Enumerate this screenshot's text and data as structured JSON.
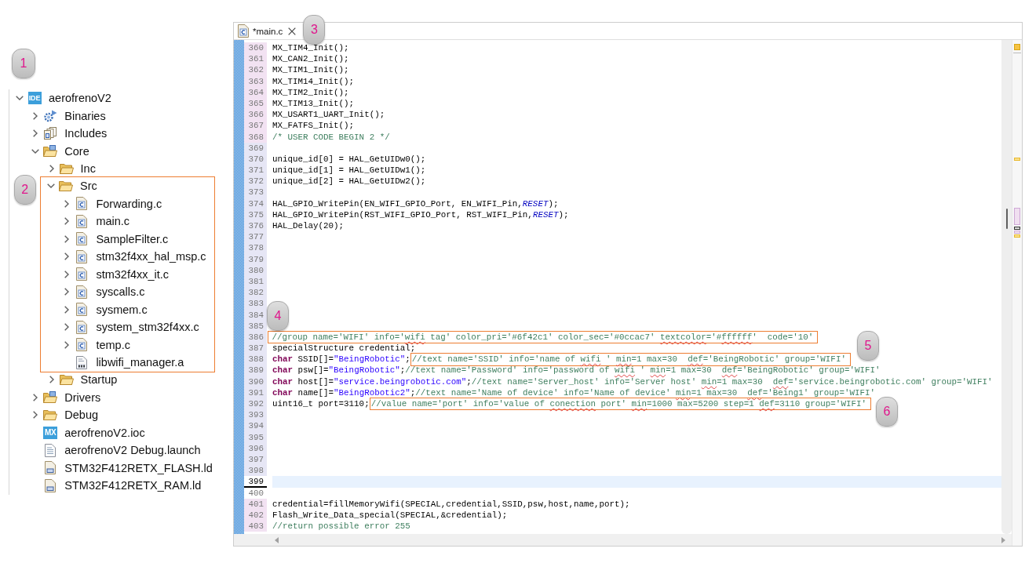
{
  "explorer": {
    "callout": "1",
    "tree": [
      {
        "label": "aerofrenoV2",
        "kind": "project",
        "badge": "IDE",
        "expanded": true,
        "highlighted": false,
        "children": [
          {
            "label": "Binaries",
            "kind": "binaries",
            "expanded": false,
            "highlighted": false
          },
          {
            "label": "Includes",
            "kind": "includes",
            "expanded": false,
            "highlighted": false
          },
          {
            "label": "Core",
            "kind": "source-folder",
            "expanded": true,
            "highlighted": false,
            "children": [
              {
                "label": "Inc",
                "kind": "folder",
                "expanded": false,
                "highlighted": false
              },
              {
                "label": "Src",
                "kind": "folder",
                "expanded": true,
                "highlighted": true,
                "callout": "2",
                "children": [
                  {
                    "label": "Forwarding.c",
                    "kind": "c-file",
                    "expanded": false,
                    "highlighted": false
                  },
                  {
                    "label": "main.c",
                    "kind": "c-file",
                    "expanded": false,
                    "highlighted": false
                  },
                  {
                    "label": "SampleFilter.c",
                    "kind": "c-file",
                    "expanded": false,
                    "highlighted": false
                  },
                  {
                    "label": "stm32f4xx_hal_msp.c",
                    "kind": "c-file",
                    "expanded": false,
                    "highlighted": false
                  },
                  {
                    "label": "stm32f4xx_it.c",
                    "kind": "c-file",
                    "expanded": false,
                    "highlighted": false
                  },
                  {
                    "label": "syscalls.c",
                    "kind": "c-file",
                    "expanded": false,
                    "highlighted": false
                  },
                  {
                    "label": "sysmem.c",
                    "kind": "c-file",
                    "expanded": false,
                    "highlighted": false
                  },
                  {
                    "label": "system_stm32f4xx.c",
                    "kind": "c-file",
                    "expanded": false,
                    "highlighted": false
                  },
                  {
                    "label": "temp.c",
                    "kind": "c-file",
                    "expanded": false,
                    "highlighted": false
                  },
                  {
                    "label": "libwifi_manager.a",
                    "kind": "archive",
                    "highlighted": false
                  }
                ]
              },
              {
                "label": "Startup",
                "kind": "folder",
                "expanded": false,
                "highlighted": false
              }
            ]
          },
          {
            "label": "Drivers",
            "kind": "source-folder",
            "expanded": false,
            "highlighted": false
          },
          {
            "label": "Debug",
            "kind": "folder",
            "expanded": false,
            "highlighted": false
          },
          {
            "label": "aerofrenoV2.ioc",
            "kind": "ioc",
            "badge": "MX",
            "highlighted": false
          },
          {
            "label": "aerofrenoV2 Debug.launch",
            "kind": "launch",
            "highlighted": false
          },
          {
            "label": "STM32F412RETX_FLASH.ld",
            "kind": "linker",
            "highlighted": false
          },
          {
            "label": "STM32F412RETX_RAM.ld",
            "kind": "linker",
            "highlighted": false
          }
        ]
      }
    ]
  },
  "editor": {
    "tabs": [
      {
        "label": "*main.c",
        "selected": true,
        "callout": "3"
      }
    ],
    "lines": [
      {
        "number": "360",
        "kind": "changed",
        "current": false,
        "segments": [
          {
            "kind": "code",
            "text": "MX_TIM4_Init();"
          }
        ]
      },
      {
        "number": "361",
        "kind": "changed",
        "current": false,
        "segments": [
          {
            "kind": "code",
            "text": "MX_CAN2_Init();"
          }
        ]
      },
      {
        "number": "362",
        "kind": "changed",
        "current": false,
        "segments": [
          {
            "kind": "code",
            "text": "MX_TIM1_Init();"
          }
        ]
      },
      {
        "number": "363",
        "kind": "changed",
        "current": false,
        "segments": [
          {
            "kind": "code",
            "text": "MX_TIM14_Init();"
          }
        ]
      },
      {
        "number": "364",
        "kind": "changed",
        "current": false,
        "segments": [
          {
            "kind": "code",
            "text": "MX_TIM2_Init();"
          }
        ]
      },
      {
        "number": "365",
        "kind": "changed",
        "current": false,
        "segments": [
          {
            "kind": "code",
            "text": "MX_TIM13_Init();"
          }
        ]
      },
      {
        "number": "366",
        "kind": "changed",
        "current": false,
        "segments": [
          {
            "kind": "code",
            "text": "MX_USART1_UART_Init();"
          }
        ]
      },
      {
        "number": "367",
        "kind": "changed",
        "current": false,
        "segments": [
          {
            "kind": "code",
            "text": "MX_FATFS_Init();"
          }
        ]
      },
      {
        "number": "368",
        "kind": "changed",
        "current": false,
        "segments": [
          {
            "kind": "comment",
            "text": "/* USER CODE BEGIN 2 */"
          }
        ]
      },
      {
        "number": "369",
        "kind": "added",
        "current": false
      },
      {
        "number": "370",
        "kind": "added",
        "current": false,
        "segments": [
          {
            "kind": "code",
            "text": "unique_id[0] = HAL_GetUIDw0();"
          }
        ]
      },
      {
        "number": "371",
        "kind": "added",
        "current": false,
        "segments": [
          {
            "kind": "code",
            "text": "unique_id[1] = HAL_GetUIDw1();"
          }
        ]
      },
      {
        "number": "372",
        "kind": "added",
        "current": false,
        "segments": [
          {
            "kind": "code",
            "text": "unique_id[2] = HAL_GetUIDw2();"
          }
        ]
      },
      {
        "number": "373",
        "kind": "added",
        "current": false
      },
      {
        "number": "374",
        "kind": "added",
        "current": false,
        "segments": [
          {
            "kind": "code",
            "text": "HAL_GPIO_WritePin(EN_WIFI_GPIO_Port, EN_WIFI_Pin,"
          },
          {
            "kind": "constant",
            "text": "RESET"
          },
          {
            "kind": "code",
            "text": ");"
          }
        ]
      },
      {
        "number": "375",
        "kind": "added",
        "current": false,
        "segments": [
          {
            "kind": "code",
            "text": "HAL_GPIO_WritePin(RST_WIFI_GPIO_Port, RST_WIFI_Pin,"
          },
          {
            "kind": "constant",
            "text": "RESET"
          },
          {
            "kind": "code",
            "text": ");"
          }
        ]
      },
      {
        "number": "376",
        "kind": "added",
        "current": false,
        "segments": [
          {
            "kind": "code",
            "text": "HAL_Delay(20);"
          }
        ]
      },
      {
        "number": "377",
        "kind": "added",
        "current": false
      },
      {
        "number": "378",
        "kind": "added",
        "current": false
      },
      {
        "number": "379",
        "kind": "added",
        "current": false
      },
      {
        "number": "380",
        "kind": "added",
        "current": false
      },
      {
        "number": "381",
        "kind": "added",
        "current": false
      },
      {
        "number": "382",
        "kind": "added",
        "current": false
      },
      {
        "number": "383",
        "kind": "added",
        "current": false
      },
      {
        "number": "384",
        "kind": "added",
        "current": false
      },
      {
        "number": "385",
        "kind": "added",
        "current": false
      },
      {
        "number": "386",
        "kind": "added",
        "current": false,
        "annotation": {
          "callout": "4",
          "segments": [
            {
              "kind": "comment",
              "text": "//group name='WIFI' info='"
            },
            {
              "kind": "misspelled",
              "text": "wifi"
            },
            {
              "kind": "comment",
              "text": " tag' color_pri='#6f42c1' color_sec='#0ccac7' "
            },
            {
              "kind": "misspelled",
              "text": "textcolor"
            },
            {
              "kind": "comment",
              "text": "='#"
            },
            {
              "kind": "misspelled",
              "text": "ffffff"
            },
            {
              "kind": "comment",
              "text": "'  code='10'"
            }
          ]
        }
      },
      {
        "number": "387",
        "kind": "added",
        "current": false,
        "segments": [
          {
            "kind": "code",
            "text": "specialStructure credential;"
          }
        ]
      },
      {
        "number": "388",
        "kind": "added",
        "current": false,
        "segments": [
          {
            "kind": "keyword",
            "text": "char"
          },
          {
            "kind": "code",
            "text": " SSID[]="
          },
          {
            "kind": "string",
            "text": "\"BeingRobotic\""
          },
          {
            "kind": "code",
            "text": ";"
          }
        ],
        "annotation": {
          "callout": "5",
          "segments": [
            {
              "kind": "comment",
              "text": "//text name='SSID' info='name of "
            },
            {
              "kind": "misspelled",
              "text": "wifi"
            },
            {
              "kind": "comment",
              "text": " ' "
            },
            {
              "kind": "misspelled",
              "text": "min"
            },
            {
              "kind": "comment",
              "text": "=1 max=30  "
            },
            {
              "kind": "misspelled",
              "text": "def"
            },
            {
              "kind": "comment",
              "text": "='BeingRobotic' group='WIFI'"
            }
          ]
        }
      },
      {
        "number": "389",
        "kind": "added",
        "current": false,
        "segments": [
          {
            "kind": "keyword",
            "text": "char"
          },
          {
            "kind": "code",
            "text": " psw[]="
          },
          {
            "kind": "string",
            "text": "\"BeingRobotic\""
          },
          {
            "kind": "code",
            "text": ";"
          },
          {
            "kind": "comment",
            "text": "//text name='Password' info='password of "
          },
          {
            "kind": "misspelled",
            "text": "wifi"
          },
          {
            "kind": "comment",
            "text": " ' "
          },
          {
            "kind": "misspelled",
            "text": "min"
          },
          {
            "kind": "comment",
            "text": "=1 max=30  "
          },
          {
            "kind": "misspelled",
            "text": "def"
          },
          {
            "kind": "comment",
            "text": "='BeingRobotic' group='WIFI'"
          }
        ]
      },
      {
        "number": "390",
        "kind": "added",
        "current": false,
        "segments": [
          {
            "kind": "keyword",
            "text": "char"
          },
          {
            "kind": "code",
            "text": " host[]="
          },
          {
            "kind": "string",
            "text": "\"service.beingrobotic.com\""
          },
          {
            "kind": "code",
            "text": ";"
          },
          {
            "kind": "comment",
            "text": "//text name='Server_host' info='Server host' "
          },
          {
            "kind": "misspelled",
            "text": "min"
          },
          {
            "kind": "comment",
            "text": "=1 max=30  "
          },
          {
            "kind": "misspelled",
            "text": "def"
          },
          {
            "kind": "comment",
            "text": "='service.beingrobotic.com' group='WIFI'"
          }
        ]
      },
      {
        "number": "391",
        "kind": "added",
        "current": false,
        "segments": [
          {
            "kind": "keyword",
            "text": "char"
          },
          {
            "kind": "code",
            "text": " name[]="
          },
          {
            "kind": "string",
            "text": "\"BeingRobotic2\""
          },
          {
            "kind": "code",
            "text": ";"
          },
          {
            "kind": "comment",
            "text": "//text name='Name of device' info='Name of device' "
          },
          {
            "kind": "misspelled",
            "text": "min"
          },
          {
            "kind": "comment",
            "text": "=1 max=30  "
          },
          {
            "kind": "misspelled",
            "text": "def"
          },
          {
            "kind": "comment",
            "text": "='Being1' group='WIFI'"
          }
        ]
      },
      {
        "number": "392",
        "kind": "added",
        "current": false,
        "segments": [
          {
            "kind": "code",
            "text": "uint16_t port=3110;"
          }
        ],
        "annotation": {
          "callout": "6",
          "segments": [
            {
              "kind": "comment",
              "text": "//value name='port' info='value of "
            },
            {
              "kind": "misspelled",
              "text": "conection"
            },
            {
              "kind": "comment",
              "text": " port' "
            },
            {
              "kind": "misspelled",
              "text": "min"
            },
            {
              "kind": "comment",
              "text": "=1000 max=5200 step=1 "
            },
            {
              "kind": "misspelled",
              "text": "def"
            },
            {
              "kind": "comment",
              "text": "=3110 group='WIFI'"
            }
          ]
        }
      },
      {
        "number": "393",
        "kind": "added",
        "current": false
      },
      {
        "number": "394",
        "kind": "added",
        "current": false
      },
      {
        "number": "395",
        "kind": "added",
        "current": false
      },
      {
        "number": "396",
        "kind": "added",
        "current": false
      },
      {
        "number": "397",
        "kind": "added",
        "current": false
      },
      {
        "number": "398",
        "kind": "added",
        "current": false
      },
      {
        "number": "399",
        "kind": "unchanged",
        "current": true
      },
      {
        "number": "400",
        "kind": "unchanged",
        "current": false
      },
      {
        "number": "401",
        "kind": "changed",
        "current": false,
        "segments": [
          {
            "kind": "code",
            "text": "credential=fillMemoryWifi(SPECIAL,credential,SSID,psw,host,name,port);"
          }
        ]
      },
      {
        "number": "402",
        "kind": "changed",
        "current": false,
        "segments": [
          {
            "kind": "code",
            "text": "Flash_Write_Data_special(SPECIAL,&credential);"
          }
        ]
      },
      {
        "number": "403",
        "kind": "changed",
        "current": false,
        "segments": [
          {
            "kind": "comment",
            "text": "//return possible error 255"
          }
        ]
      }
    ]
  }
}
